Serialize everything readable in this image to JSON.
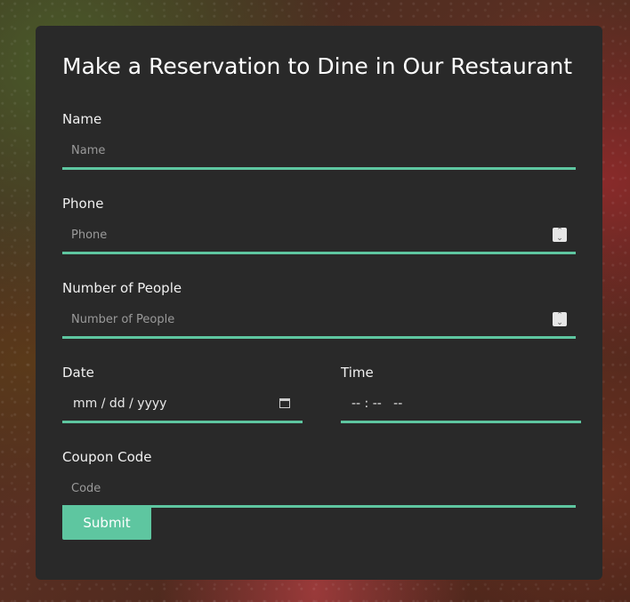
{
  "form": {
    "title": "Make a Reservation to Dine in Our Restaurant",
    "name": {
      "label": "Name",
      "placeholder": "Name"
    },
    "phone": {
      "label": "Phone",
      "placeholder": "Phone"
    },
    "people": {
      "label": "Number of People",
      "placeholder": "Number of People"
    },
    "date": {
      "label": "Date",
      "value": "mm / dd / yyyy"
    },
    "time": {
      "label": "Time",
      "value": "-- : --   --"
    },
    "coupon": {
      "label": "Coupon Code",
      "placeholder": "Code"
    },
    "submit_label": "Submit"
  },
  "colors": {
    "accent": "#5ec6a0",
    "card": "#292929"
  }
}
